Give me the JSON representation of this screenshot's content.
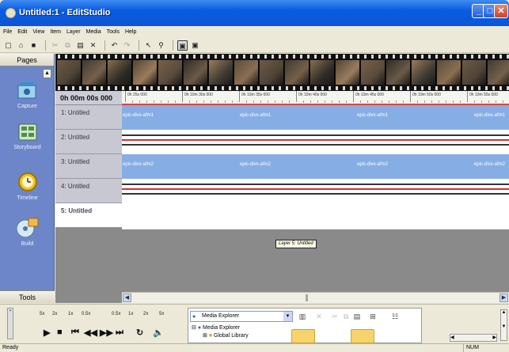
{
  "window": {
    "title": "Untitled:1 - EditStudio"
  },
  "menu": [
    "File",
    "Edit",
    "View",
    "Item",
    "Layer",
    "Media",
    "Tools",
    "Help"
  ],
  "toolbar": [
    {
      "icon": "new-icon",
      "glyph": "▢"
    },
    {
      "icon": "open-icon",
      "glyph": "⌂"
    },
    {
      "icon": "save-icon",
      "glyph": "■"
    },
    {
      "sep": true
    },
    {
      "icon": "cut-icon",
      "glyph": "✂",
      "dim": true
    },
    {
      "icon": "copy-icon",
      "glyph": "⧉",
      "dim": true
    },
    {
      "icon": "paste-icon",
      "glyph": "▤"
    },
    {
      "icon": "delete-icon",
      "glyph": "✕"
    },
    {
      "sep": true
    },
    {
      "icon": "undo-icon",
      "glyph": "↶"
    },
    {
      "icon": "redo-icon",
      "glyph": "↷",
      "dim": true
    },
    {
      "sep": true
    },
    {
      "icon": "pointer-icon",
      "glyph": "↖"
    },
    {
      "icon": "zoom-icon",
      "glyph": "⚲"
    },
    {
      "sep": true
    },
    {
      "icon": "preview-icon",
      "glyph": "▣",
      "boxed": true
    },
    {
      "icon": "snapshot-icon",
      "glyph": "▣"
    }
  ],
  "pages": {
    "header": "Pages",
    "items": [
      {
        "label": "Capture",
        "icon": "capture-icon"
      },
      {
        "label": "Storyboard",
        "icon": "storyboard-icon"
      },
      {
        "label": "Timeline",
        "icon": "timeline-icon"
      },
      {
        "label": "Build",
        "icon": "build-icon"
      }
    ],
    "footer": "Tools"
  },
  "timeline": {
    "current_time": "0h 00m 00s 000",
    "ruler": [
      "0h 25s 000",
      "0h 10m 30s 000",
      "0h 10m 35s 000",
      "0h 10m 40s 000",
      "0h 10m 45s 000",
      "0h 10m 50s 000",
      "0h 10m 55s 000"
    ],
    "layers": [
      {
        "label": "1: Untitled"
      },
      {
        "label": "2: Untitled"
      },
      {
        "label": "3: Untitled"
      },
      {
        "label": "4: Untitled"
      },
      {
        "label": "5: Untitled"
      }
    ],
    "clips_track1": [
      "epic-divx-afm1",
      "epic-divx-afm1",
      "epic-divx-afm1",
      "epic-divx-afm1"
    ],
    "clips_track3": [
      "epic-divx-afm2",
      "epic-divx-afm2",
      "epic-divx-afm2",
      "epic-divx-afm2"
    ],
    "tooltip": "Layer 5: Untitled"
  },
  "playback": {
    "speeds": [
      "5x",
      "2x",
      "1x",
      "0.5x",
      "0.5x",
      "1x",
      "2x",
      "5x"
    ]
  },
  "media_explorer": {
    "selected": "Media Explorer",
    "tree": [
      "Media Explorer",
      "Global Library"
    ]
  },
  "status": {
    "text": "Ready",
    "num": "NUM"
  },
  "colors": {
    "title_bar": "#0b56d6",
    "pages_panel": "#6d86c9",
    "clip_track": "#87aee4",
    "ruler_marker": "#dd4444"
  }
}
